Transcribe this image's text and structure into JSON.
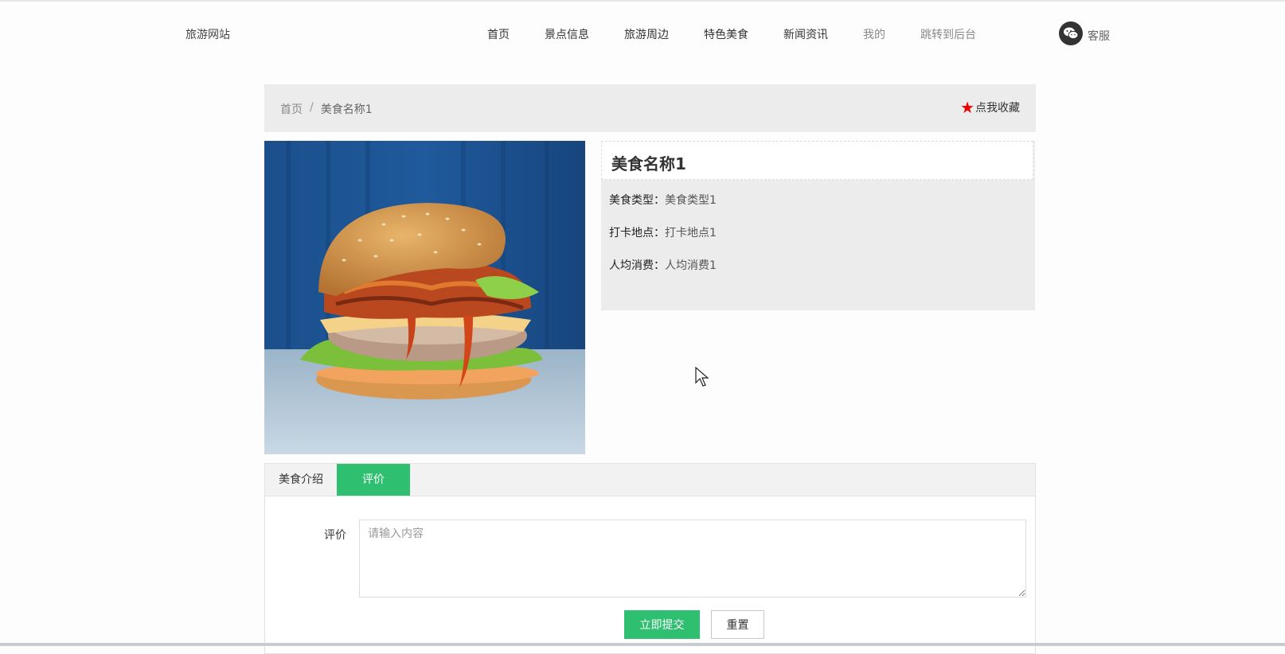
{
  "header": {
    "site_title": "旅游网站",
    "nav": [
      {
        "label": "首页"
      },
      {
        "label": "景点信息"
      },
      {
        "label": "旅游周边"
      },
      {
        "label": "特色美食"
      },
      {
        "label": "新闻资讯"
      },
      {
        "label": "我的"
      },
      {
        "label": "跳转到后台"
      }
    ],
    "service_label": "客服"
  },
  "breadcrumb": {
    "home": "首页",
    "separator": "/",
    "current": "美食名称1",
    "favorite_label": "点我收藏"
  },
  "detail": {
    "title": "美食名称1",
    "fields": [
      {
        "key": "美食类型：",
        "value": "美食类型1"
      },
      {
        "key": "打卡地点：",
        "value": "打卡地点1"
      },
      {
        "key": "人均消费：",
        "value": "人均消费1"
      }
    ]
  },
  "tabs": [
    {
      "label": "美食介绍"
    },
    {
      "label": "评价"
    }
  ],
  "comment_form": {
    "label": "评价",
    "placeholder": "请输入内容",
    "submit_label": "立即提交",
    "reset_label": "重置"
  },
  "colors": {
    "accent": "#2fbf71",
    "favorite_star": "#ee0000"
  }
}
